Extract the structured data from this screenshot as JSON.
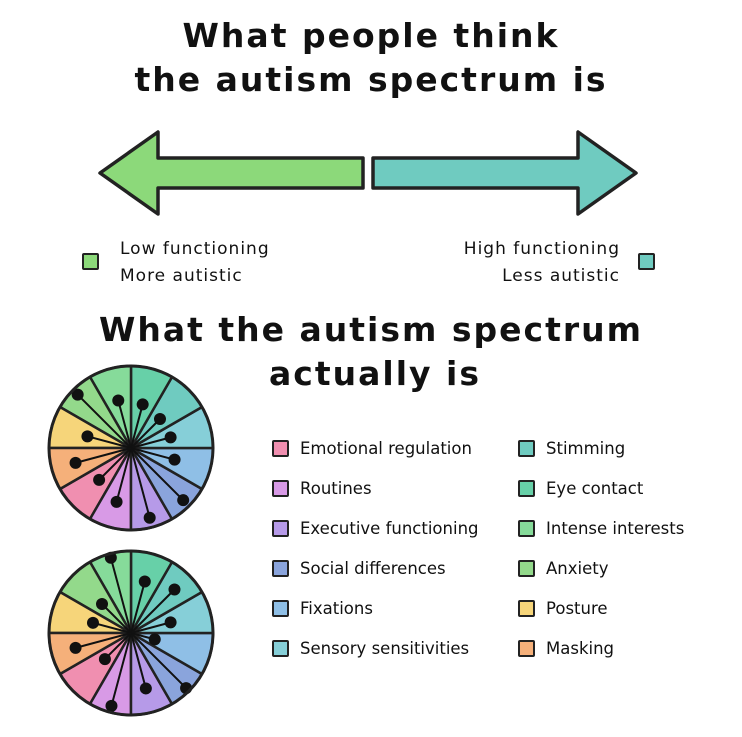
{
  "title_top": [
    "What people think",
    "the autism spectrum is"
  ],
  "low_end": {
    "lines": [
      "Low functioning",
      "More autistic"
    ],
    "color": "#8cd97a"
  },
  "high_end": {
    "lines": [
      "High functioning",
      "Less autistic"
    ],
    "color": "#6fcbc0"
  },
  "title_bottom": [
    "What the autism spectrum",
    "actually is"
  ],
  "traits": [
    {
      "label": "Emotional regulation",
      "color": "#f08fb0"
    },
    {
      "label": "Routines",
      "color": "#d89ae6"
    },
    {
      "label": "Executive functioning",
      "color": "#b69ae8"
    },
    {
      "label": "Social differences",
      "color": "#8aa4dc"
    },
    {
      "label": "Fixations",
      "color": "#8fbfe6"
    },
    {
      "label": "Sensory sensitivities",
      "color": "#86cfd8"
    },
    {
      "label": "Stimming",
      "color": "#6fcbc0"
    },
    {
      "label": "Eye contact",
      "color": "#67d0a8"
    },
    {
      "label": "Intense interests",
      "color": "#86db9a"
    },
    {
      "label": "Anxiety",
      "color": "#93d98b"
    },
    {
      "label": "Posture",
      "color": "#f6d57a"
    },
    {
      "label": "Masking",
      "color": "#f5b07a"
    }
  ],
  "profiles": [
    {
      "levels": [
        0.55,
        0.68,
        0.88,
        0.9,
        0.55,
        0.5,
        0.5,
        0.55,
        0.6,
        0.92,
        0.55,
        0.7
      ]
    },
    {
      "levels": [
        0.45,
        0.92,
        0.7,
        0.95,
        0.3,
        0.5,
        0.75,
        0.65,
        0.95,
        0.5,
        0.48,
        0.7
      ]
    }
  ]
}
